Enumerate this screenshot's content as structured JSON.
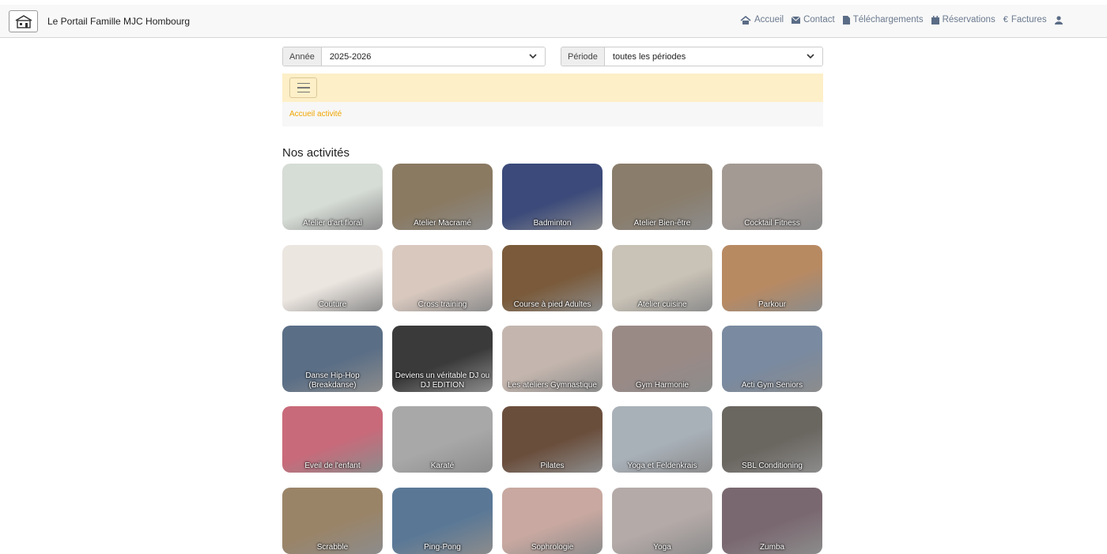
{
  "navbar": {
    "title": "Le Portail Famille MJC Hombourg",
    "links": [
      {
        "label": "Accueil",
        "icon": "home-icon"
      },
      {
        "label": "Contact",
        "icon": "envelope-icon"
      },
      {
        "label": "Téléchargements",
        "icon": "file-icon"
      },
      {
        "label": "Réservations",
        "icon": "calendar-icon"
      },
      {
        "label": "Factures",
        "icon": "euro-icon"
      }
    ],
    "user_icon": "user-icon"
  },
  "filters": {
    "year_label": "Année",
    "year_value": "2025-2026",
    "period_label": "Période",
    "period_value": "toutes les périodes"
  },
  "breadcrumb": "Accueil activité",
  "section_title": "Nos activités",
  "activities": [
    {
      "label": "Atelier d'art floral",
      "bg": "#d6dcd6"
    },
    {
      "label": "Atelier Macramé",
      "bg": "#8a7a62"
    },
    {
      "label": "Badminton",
      "bg": "#3b4a7a"
    },
    {
      "label": "Atelier Bien-être",
      "bg": "#8a7d6b"
    },
    {
      "label": "Cocktail Fitness",
      "bg": "#a49a94"
    },
    {
      "label": "Couture",
      "bg": "#ece6e0"
    },
    {
      "label": "Cross training",
      "bg": "#d8c8be"
    },
    {
      "label": "Course à pied Adultes",
      "bg": "#7a5a3a"
    },
    {
      "label": "Atelier cuisine",
      "bg": "#c9c2b6"
    },
    {
      "label": "Parkour",
      "bg": "#b88a62"
    },
    {
      "label": "Danse Hip-Hop (Breakdanse)",
      "bg": "#5a6e86"
    },
    {
      "label": "Deviens un véritable DJ ou DJ EDITION",
      "bg": "#3a3a3a"
    },
    {
      "label": "Les ateliers Gymnastique",
      "bg": "#c4b6ae"
    },
    {
      "label": "Gym Harmonie",
      "bg": "#9a8a86"
    },
    {
      "label": "Acti Gym Seniors",
      "bg": "#7a8aa0"
    },
    {
      "label": "Eveil de l'enfant",
      "bg": "#c86a7a"
    },
    {
      "label": "Karaté",
      "bg": "#a8a8a8"
    },
    {
      "label": "Pilates",
      "bg": "#6a4e3c"
    },
    {
      "label": "Yoga et Feldenkrais",
      "bg": "#a8b0b8"
    },
    {
      "label": "SBL Conditioning",
      "bg": "#6a6660"
    },
    {
      "label": "Scrabble",
      "bg": "#9a8468"
    },
    {
      "label": "Ping-Pong",
      "bg": "#5a7896"
    },
    {
      "label": "Sophrologie",
      "bg": "#c8a8a0"
    },
    {
      "label": "Yoga",
      "bg": "#b4aaa8"
    },
    {
      "label": "Zumba",
      "bg": "#7a6870"
    }
  ]
}
